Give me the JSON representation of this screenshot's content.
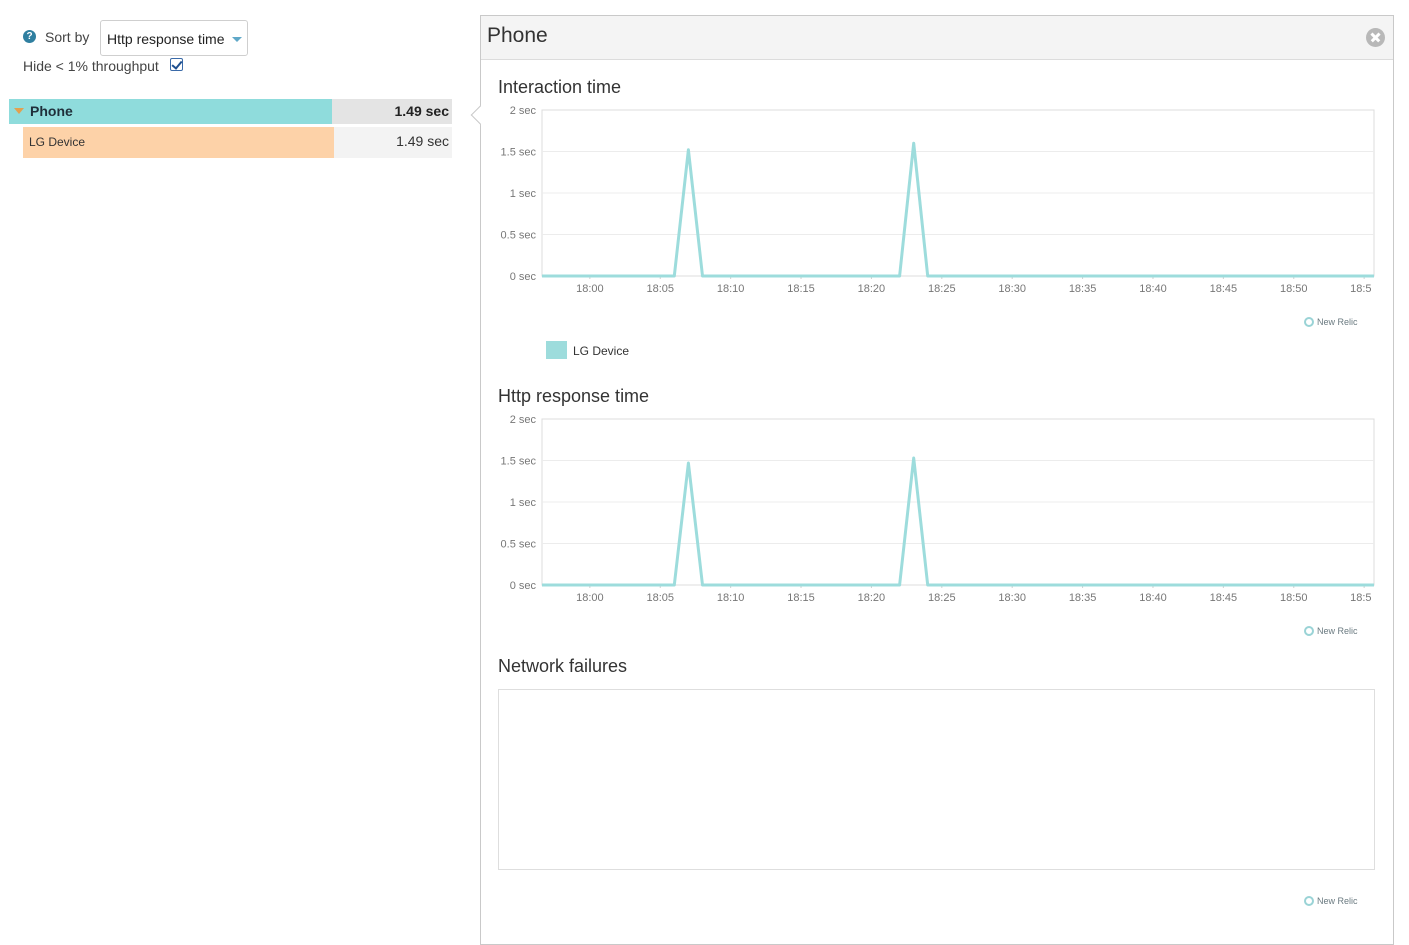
{
  "controls": {
    "help_icon": "?",
    "sort_label": "Sort by",
    "sort_value": "Http response time",
    "hide_label": "Hide < 1% throughput",
    "hide_checked": true
  },
  "tree": {
    "phone": {
      "label": "Phone",
      "value": "1.49 sec"
    },
    "lg_device": {
      "label": "LG Device",
      "value": "1.49 sec"
    }
  },
  "panel": {
    "title": "Phone",
    "brand": "New Relic",
    "series_color": "#9ddcdc",
    "legend_label": "LG Device"
  },
  "chart_data": [
    {
      "type": "line",
      "title": "Interaction time",
      "yticks": [
        "0 sec",
        "0.5 sec",
        "1 sec",
        "1.5 sec",
        "2 sec"
      ],
      "ylim": [
        0,
        2
      ],
      "xticks": [
        "18:00",
        "18:05",
        "18:10",
        "18:15",
        "18:20",
        "18:25",
        "18:30",
        "18:35",
        "18:40",
        "18:45",
        "18:50",
        "18:5"
      ],
      "xlim_minutes": [
        56.6,
        115.7
      ],
      "series": [
        {
          "name": "LG Device",
          "points": [
            [
              56.6,
              0
            ],
            [
              66,
              0
            ],
            [
              67,
              1.52
            ],
            [
              68,
              0
            ],
            [
              82,
              0
            ],
            [
              83,
              1.6
            ],
            [
              84,
              0
            ],
            [
              115.7,
              0
            ]
          ]
        }
      ]
    },
    {
      "type": "line",
      "title": "Http response time",
      "yticks": [
        "0 sec",
        "0.5 sec",
        "1 sec",
        "1.5 sec",
        "2 sec"
      ],
      "ylim": [
        0,
        2
      ],
      "xticks": [
        "18:00",
        "18:05",
        "18:10",
        "18:15",
        "18:20",
        "18:25",
        "18:30",
        "18:35",
        "18:40",
        "18:45",
        "18:50",
        "18:5"
      ],
      "xlim_minutes": [
        56.6,
        115.7
      ],
      "series": [
        {
          "name": "LG Device",
          "points": [
            [
              56.6,
              0
            ],
            [
              66,
              0
            ],
            [
              67,
              1.47
            ],
            [
              68,
              0
            ],
            [
              82,
              0
            ],
            [
              83,
              1.53
            ],
            [
              84,
              0
            ],
            [
              115.7,
              0
            ]
          ]
        }
      ]
    },
    {
      "type": "line",
      "title": "Network failures",
      "series": []
    }
  ]
}
